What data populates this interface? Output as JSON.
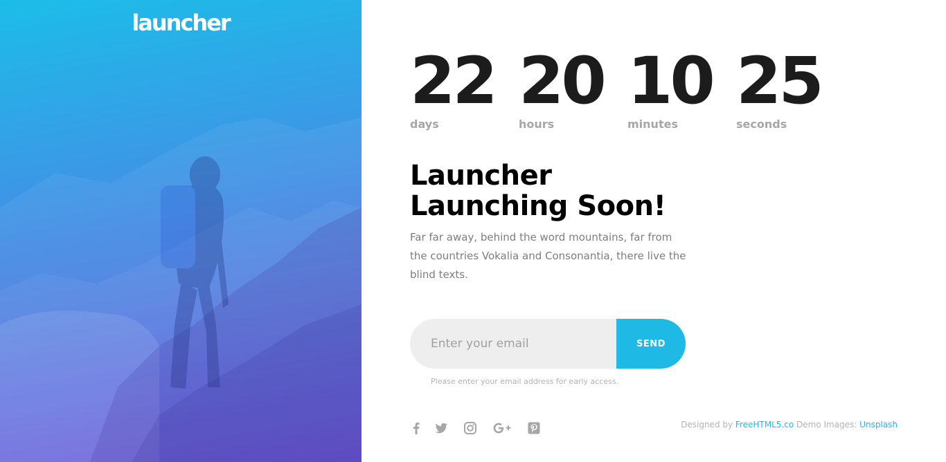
{
  "brand": {
    "logo_text": "launcher"
  },
  "countdown": [
    {
      "value": "22",
      "label": "days"
    },
    {
      "value": "20",
      "label": "hours"
    },
    {
      "value": "10",
      "label": "minutes"
    },
    {
      "value": "25",
      "label": "seconds"
    }
  ],
  "headline": {
    "line1": "Launcher",
    "line2": "Launching Soon!"
  },
  "description": "Far far away, behind the word mountains, far from the countries Vokalia and Consonantia, there live the blind texts.",
  "subscribe": {
    "placeholder": "Enter your email",
    "value": "",
    "button_label": "SEND",
    "hint": "Please enter your email address for early access."
  },
  "social": [
    {
      "name": "facebook",
      "icon": "facebook-icon"
    },
    {
      "name": "twitter",
      "icon": "twitter-icon"
    },
    {
      "name": "instagram",
      "icon": "instagram-icon"
    },
    {
      "name": "google-plus",
      "icon": "google-plus-icon"
    },
    {
      "name": "pinterest",
      "icon": "pinterest-icon"
    }
  ],
  "footer": {
    "designed_by_prefix": "Designed by",
    "designed_by_link": "FreeHTML5.co",
    "images_prefix": "Demo Images:",
    "images_link": "Unsplash"
  },
  "colors": {
    "accent": "#1eb9e4",
    "hero_gradient_top": "#1cbde8",
    "hero_gradient_bottom": "#6247d6",
    "countdown_text": "#1c1c1c",
    "muted_text": "#a6a6a6"
  }
}
